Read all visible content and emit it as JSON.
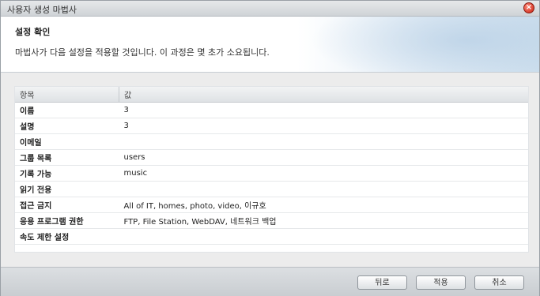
{
  "window": {
    "title": "사용자 생성 마법사",
    "close_icon": "close-icon"
  },
  "header": {
    "title": "설정 확인",
    "subtitle": "마법사가 다음 설정을 적용할 것입니다. 이 과정은 몇 초가 소요됩니다."
  },
  "table": {
    "columns": [
      "항목",
      "값"
    ],
    "rows": [
      {
        "key": "이름",
        "value": "3"
      },
      {
        "key": "설명",
        "value": "3"
      },
      {
        "key": "이메일",
        "value": ""
      },
      {
        "key": "그룹 목록",
        "value": "users"
      },
      {
        "key": "기록 가능",
        "value": "music"
      },
      {
        "key": "읽기 전용",
        "value": ""
      },
      {
        "key": "접근 금지",
        "value": "All of IT, homes, photo, video, 이규호"
      },
      {
        "key": "응용 프로그램 권한",
        "value": "FTP, File Station, WebDAV, 네트워크 백업"
      },
      {
        "key": "속도 제한 설정",
        "value": ""
      }
    ]
  },
  "buttons": {
    "back": "뒤로",
    "apply": "적용",
    "cancel": "취소"
  }
}
